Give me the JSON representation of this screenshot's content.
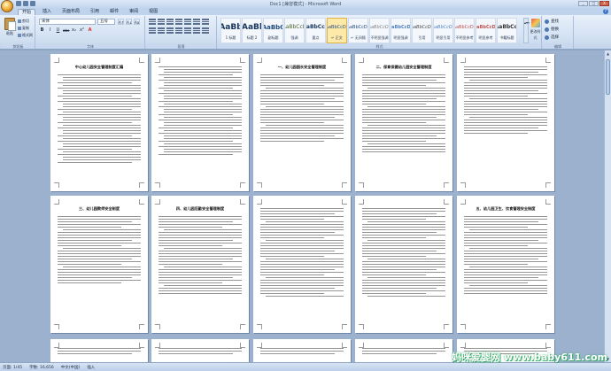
{
  "window": {
    "title": "Doc1 [兼容模式] - Microsoft Word",
    "close_symbol": "X",
    "minimize_symbol": "_",
    "maximize_symbol": "□"
  },
  "tabs": [
    "开始",
    "插入",
    "页面布局",
    "引用",
    "邮件",
    "审阅",
    "视图"
  ],
  "help_symbol": "?",
  "ribbon": {
    "clipboard": {
      "label": "剪贴板",
      "paste": "粘贴",
      "cut": "剪切",
      "copy": "复制",
      "format_painter": "格式刷"
    },
    "font": {
      "label": "字体",
      "name": "宋体",
      "size": "五号",
      "bold": "B",
      "italic": "I",
      "underline": "U",
      "strike": "abe",
      "sub": "x₂",
      "sup": "x²",
      "color_a": "A",
      "grow": "A↑",
      "shrink": "A↓",
      "clear": "Aa"
    },
    "paragraph": {
      "label": "段落"
    },
    "styles": {
      "label": "样式",
      "items": [
        {
          "sample": "AaBb",
          "name": "1 标题"
        },
        {
          "sample": "AaBl",
          "name": "标题 2"
        },
        {
          "sample": "AaBbC",
          "name": "副标题"
        },
        {
          "sample": "AaBbCcD",
          "name": "强调"
        },
        {
          "sample": "AaBbCcD",
          "name": "要点"
        },
        {
          "sample": "AaBbCcDc",
          "name": "↵ 正文"
        },
        {
          "sample": "AaBbCcDc",
          "name": "↵ 无间隔"
        },
        {
          "sample": "AaBbCcDc",
          "name": "不明显强调"
        },
        {
          "sample": "AaBbCcDc",
          "name": "明显强调"
        },
        {
          "sample": "AaBbCcDc",
          "name": "引用"
        },
        {
          "sample": "AaBbCcDc",
          "name": "明显引用"
        },
        {
          "sample": "AaBbCcDc",
          "name": "不明显参考"
        },
        {
          "sample": "AaBbCcDc",
          "name": "明显参考"
        },
        {
          "sample": "AaBbCcI",
          "name": "书籍标题"
        }
      ],
      "change_styles": "更改样式",
      "scroll_symbol": "▴▾▿"
    },
    "editing": {
      "label": "编辑",
      "find": "查找",
      "replace": "替换",
      "select": "选择"
    }
  },
  "pages": [
    {
      "title": "中心幼儿园安全管理制度汇编",
      "lines": 34,
      "kind": "toc"
    },
    {
      "title": "",
      "lines": 34,
      "kind": "toc"
    },
    {
      "title": "一、幼儿园园长安全管理制度",
      "lines": 26,
      "kind": "text"
    },
    {
      "title": "二、保育保健幼儿园安全管理制度",
      "lines": 30,
      "kind": "text"
    },
    {
      "title": "",
      "lines": 26,
      "kind": "text"
    },
    {
      "title": "三、幼儿园教师安全制度",
      "lines": 26,
      "kind": "text"
    },
    {
      "title": "四、幼儿园后勤安全管理制度",
      "lines": 30,
      "kind": "text"
    },
    {
      "title": "",
      "lines": 34,
      "kind": "text"
    },
    {
      "title": "",
      "lines": 34,
      "kind": "text"
    },
    {
      "title": "五、幼儿园卫生、饮食管理安全制度",
      "lines": 30,
      "kind": "text"
    },
    {
      "title": "",
      "lines": 3,
      "kind": "text"
    },
    {
      "title": "",
      "lines": 3,
      "kind": "text"
    },
    {
      "title": "",
      "lines": 3,
      "kind": "text"
    },
    {
      "title": "",
      "lines": 3,
      "kind": "text"
    },
    {
      "title": "",
      "lines": 3,
      "kind": "text"
    }
  ],
  "status": {
    "page": "页面: 1/45",
    "words": "字数: 16,656",
    "lang": "中文(中国)",
    "mode": "插入"
  },
  "watermark": "妈咪爱婴网 www.baby611.com"
}
